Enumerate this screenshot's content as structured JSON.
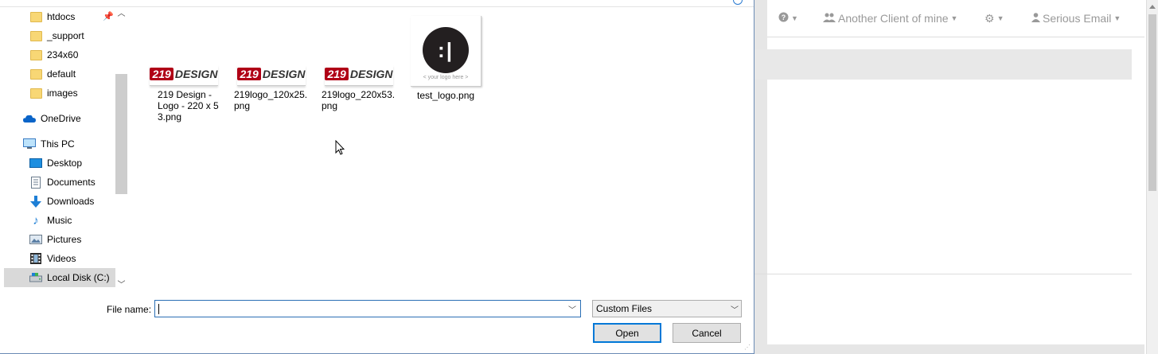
{
  "background_app": {
    "nav": [
      {
        "icon": "question-circle-icon",
        "label": ""
      },
      {
        "icon": "users-icon",
        "label": "Another Client of mine"
      },
      {
        "icon": "gear-icon",
        "label": ""
      },
      {
        "icon": "user-icon",
        "label": "Serious Email"
      }
    ]
  },
  "dialog": {
    "nav_pane": {
      "items": [
        {
          "label": "htdocs",
          "icon": "folder-icon",
          "pinned": true
        },
        {
          "label": "_support",
          "icon": "folder-icon"
        },
        {
          "label": "234x60",
          "icon": "folder-icon"
        },
        {
          "label": "default",
          "icon": "folder-icon"
        },
        {
          "label": "images",
          "icon": "folder-icon"
        },
        {
          "label": "OneDrive",
          "icon": "onedrive-icon"
        },
        {
          "label": "This PC",
          "icon": "computer-icon"
        },
        {
          "label": "Desktop",
          "icon": "desktop-icon"
        },
        {
          "label": "Documents",
          "icon": "documents-icon"
        },
        {
          "label": "Downloads",
          "icon": "downloads-icon"
        },
        {
          "label": "Music",
          "icon": "music-icon"
        },
        {
          "label": "Pictures",
          "icon": "pictures-icon"
        },
        {
          "label": "Videos",
          "icon": "videos-icon"
        },
        {
          "label": "Local Disk (C:)",
          "icon": "drive-icon",
          "selected": true
        }
      ]
    },
    "files": [
      {
        "name": "219 Design - Logo - 220 x 53.png",
        "logo_num": "219",
        "logo_word": "DESIGN"
      },
      {
        "name": "219logo_120x25.png",
        "logo_num": "219",
        "logo_word": "DESIGN"
      },
      {
        "name": "219logo_220x53.png",
        "logo_num": "219",
        "logo_word": "DESIGN"
      },
      {
        "name": "test_logo.png",
        "circle_text": ":|",
        "caption": "< your logo here >"
      }
    ],
    "file_name_label": "File name:",
    "file_name_value": "",
    "file_type": "Custom Files",
    "open_button": "Open",
    "cancel_button": "Cancel"
  },
  "colors": {
    "logo_red": "#b00016",
    "accent_blue": "#0078d7"
  }
}
